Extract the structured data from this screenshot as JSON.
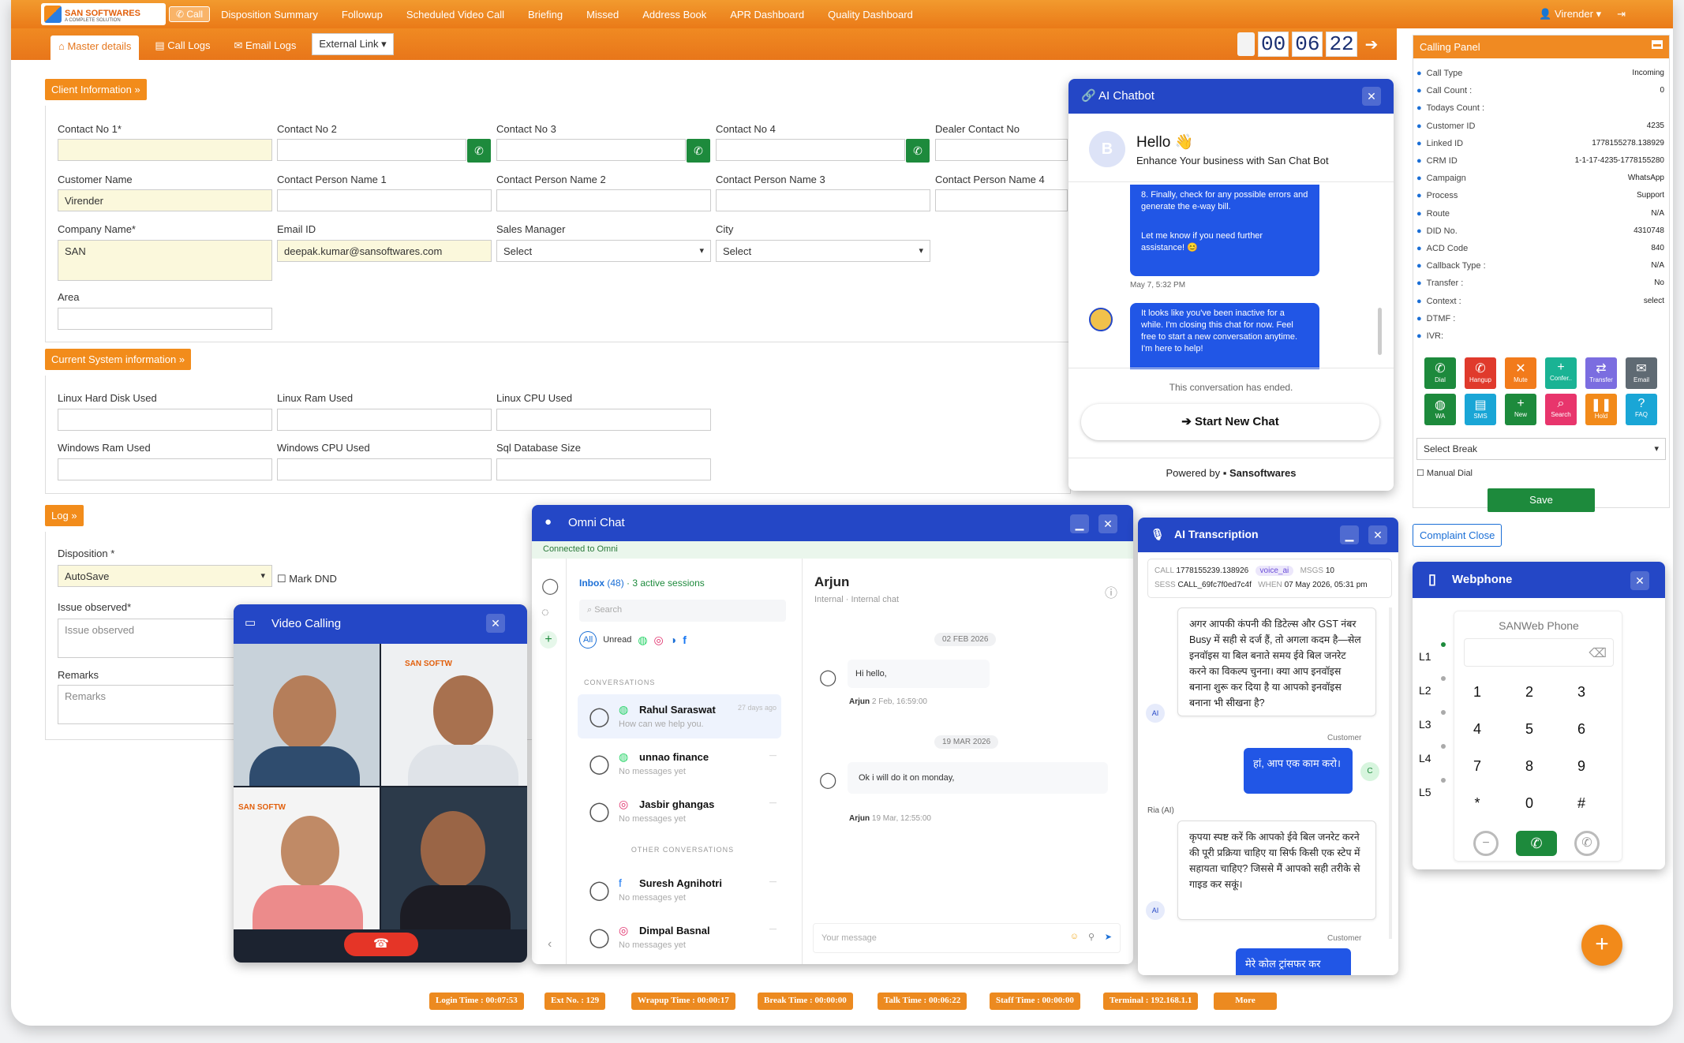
{
  "topbar": {
    "brand": "SAN SOFTWARES",
    "brand_sub": "A COMPLETE SOLUTION",
    "call_btn": "Call",
    "nav": [
      "Disposition Summary",
      "Followup",
      "Scheduled Video Call",
      "Briefing",
      "Missed",
      "Address Book",
      "APR Dashboard",
      "Quality Dashboard"
    ],
    "user": "Virender"
  },
  "tabs": [
    "Master details",
    "Call Logs",
    "Email Logs"
  ],
  "external_link": "External Link",
  "timer": {
    "h": "00",
    "m": "06",
    "s": "22"
  },
  "client_info": {
    "title": "Client Information",
    "contact_no_1": "Contact No 1*",
    "contact_no_2": "Contact No 2",
    "contact_no_3": "Contact No 3",
    "contact_no_4": "Contact No 4",
    "dealer_contact": "Dealer Contact No",
    "customer_name": "Customer Name",
    "customer_name_val": "Virender",
    "cp1": "Contact Person Name 1",
    "cp2": "Contact Person Name 2",
    "cp3": "Contact Person Name 3",
    "cp4": "Contact Person Name 4",
    "company": "Company Name*",
    "company_val": "SAN",
    "email": "Email ID",
    "email_val": "deepak.kumar@sansoftwares.com",
    "sales_manager": "Sales Manager",
    "city": "City",
    "select": "Select",
    "area": "Area"
  },
  "system_info": {
    "title": "Current System information",
    "linux_hd": "Linux Hard Disk Used",
    "linux_ram": "Linux Ram Used",
    "linux_cpu": "Linux CPU Used",
    "win_ram": "Windows Ram Used",
    "win_cpu": "Windows CPU Used",
    "sql": "Sql Database Size"
  },
  "log": {
    "title": "Log",
    "disposition": "Disposition *",
    "disposition_val": "AutoSave",
    "mark_dnd": "Mark DND",
    "issue": "Issue observed*",
    "issue_ph": "Issue observed",
    "remarks": "Remarks",
    "remarks_ph": "Remarks"
  },
  "calling_panel": {
    "title": "Calling Panel",
    "rows": [
      {
        "k": "Call Type",
        "v": "Incoming"
      },
      {
        "k": "Call Count :",
        "v": "0"
      },
      {
        "k": "Todays Count :",
        "v": ""
      },
      {
        "k": "Customer ID",
        "v": "4235"
      },
      {
        "k": "Linked ID",
        "v": "1778155278.138929"
      },
      {
        "k": "CRM ID",
        "v": "1-1-17-4235-1778155280"
      },
      {
        "k": "Campaign",
        "v": "WhatsApp"
      },
      {
        "k": "Process",
        "v": "Support"
      },
      {
        "k": "Route",
        "v": "N/A"
      },
      {
        "k": "DID No.",
        "v": "4310748"
      },
      {
        "k": "ACD Code",
        "v": "840"
      },
      {
        "k": "Callback Type :",
        "v": "N/A"
      },
      {
        "k": "Transfer :",
        "v": "No"
      },
      {
        "k": "Context :",
        "v": "select"
      },
      {
        "k": "DTMF :",
        "v": ""
      },
      {
        "k": "IVR:",
        "v": ""
      }
    ],
    "actions": [
      {
        "l": "Dial",
        "c": "#1d8a3c",
        "i": "✆"
      },
      {
        "l": "Hangup",
        "c": "#e03a2c",
        "i": "✆"
      },
      {
        "l": "Mute",
        "c": "#f27b1b",
        "i": "✕"
      },
      {
        "l": "Confer..",
        "c": "#1ab394",
        "i": "+"
      },
      {
        "l": "Transfer",
        "c": "#7b6de0",
        "i": "⇄"
      },
      {
        "l": "Email",
        "c": "#5f6a73",
        "i": "✉"
      },
      {
        "l": "WA",
        "c": "#1d8a3c",
        "i": "◍"
      },
      {
        "l": "SMS",
        "c": "#1aa6d6",
        "i": "▤"
      },
      {
        "l": "New",
        "c": "#1d8a3c",
        "i": "+"
      },
      {
        "l": "Search",
        "c": "#e8356c",
        "i": "⌕"
      },
      {
        "l": "Hold",
        "c": "#f28a1a",
        "i": "❚❚"
      },
      {
        "l": "FAQ",
        "c": "#1aa6d6",
        "i": "?"
      }
    ],
    "select_break": "Select Break",
    "manual_dial": "Manual Dial",
    "save": "Save",
    "complaint_close": "Complaint Close"
  },
  "chatbot": {
    "title": "AI Chatbot",
    "avatar": "B",
    "hello": "Hello",
    "tagline": "Enhance Your business with San Chat Bot",
    "msg1": "8. Finally, check for any possible errors and generate the e-way bill.",
    "msg1b": "Let me know if you need further assistance! 😊",
    "time1": "May 7, 5:32 PM",
    "msg2": "It looks like you've been inactive for a while. I'm closing this chat for now. Feel free to start a new conversation anytime. I'm here to help!",
    "ended": "This conversation has ended.",
    "start": "Start New Chat",
    "powered": "Powered by",
    "brand": "Sansoftwares"
  },
  "omni": {
    "title": "Omni Chat",
    "connected": "Connected to Omni",
    "inbox": "Inbox",
    "inbox_count": "(48)",
    "active": "· 3 active sessions",
    "search": "Search",
    "filter_all": "All",
    "filter_unread": "Unread",
    "conversations": "CONVERSATIONS",
    "other": "OTHER CONVERSATIONS",
    "convs": [
      {
        "name": "Rahul Saraswat",
        "sub": "How can we help you.",
        "time": "27 days ago",
        "icon": "◍",
        "color": "#25d366"
      },
      {
        "name": "unnao finance",
        "sub": "No messages yet",
        "time": "—",
        "icon": "◍",
        "color": "#25d366"
      },
      {
        "name": "Jasbir ghangas",
        "sub": "No messages yet",
        "time": "—",
        "icon": "◎",
        "color": "#e1306c"
      },
      {
        "name": "Suresh Agnihotri",
        "sub": "No messages yet",
        "time": "—",
        "icon": "f",
        "color": "#1877f2"
      },
      {
        "name": "Dimpal Basnal",
        "sub": "No messages yet",
        "time": "—",
        "icon": "◎",
        "color": "#e1306c"
      }
    ],
    "contact": "Arjun",
    "contact_sub": "Internal · Internal chat",
    "date1": "02 FEB 2026",
    "m1": "Hi hello,",
    "m1_meta_name": "Arjun",
    "m1_meta_time": "2 Feb, 16:59:00",
    "date2": "19 MAR 2026",
    "m2": "Ok i will do it on monday,",
    "m2_meta_name": "Arjun",
    "m2_meta_time": "19 Mar, 12:55:00",
    "placeholder": "Your message"
  },
  "ai_trans": {
    "title": "AI Transcription",
    "call_k": "CALL",
    "call_v": "1778155239.138926",
    "tag": "voice_ai",
    "msgs_k": "MSGS",
    "msgs_v": "10",
    "sess_k": "SESS",
    "sess_v": "CALL_69fc7f0ed7c4f",
    "when_k": "WHEN",
    "when_v": "07 May 2026, 05:31 pm",
    "ai1": "अगर आपकी कंपनी की डिटेल्स और GST नंबर Busy में सही से दर्ज हैं, तो अगला कदम है—सेल इनवॉइस या बिल बनाते समय ईवे बिल जनरेट करने का विकल्प चुनना। क्या आप इनवॉइस बनाना शुरू कर दिया है या आपको इनवॉइस बनाना भी सीखना है?",
    "customer_label": "Customer",
    "c1": "हां, आप एक काम करो।",
    "ria": "Ria (AI)",
    "ai2": "कृपया स्पष्ट करें कि आपको ईवे बिल जनरेट करने की पूरी प्रक्रिया चाहिए या सिर्फ किसी एक स्टेप में सहायता चाहिए? जिससे मैं आपको सही तरीके से गाइड कर सकूं।",
    "c2": "मेरे कोल ट्रांसफर कर",
    "ai_badge": "AI",
    "c_badge": "C"
  },
  "webphone": {
    "title": "Webphone",
    "subtitle": "SANWeb Phone",
    "lines": [
      "L1",
      "L2",
      "L3",
      "L4",
      "L5"
    ],
    "keys": [
      "1",
      "2",
      "3",
      "4",
      "5",
      "6",
      "7",
      "8",
      "9",
      "*",
      "0",
      "#"
    ]
  },
  "video": {
    "title": "Video Calling",
    "brand": "SAN SOFTW"
  },
  "status": [
    "Login Time : 00:07:53",
    "Ext No. : 129",
    "Wrapup Time : 00:00:17",
    "Break Time : 00:00:00",
    "Talk Time : 00:06:22",
    "Staff Time : 00:00:00",
    "Terminal : 192.168.1.1",
    "More"
  ]
}
